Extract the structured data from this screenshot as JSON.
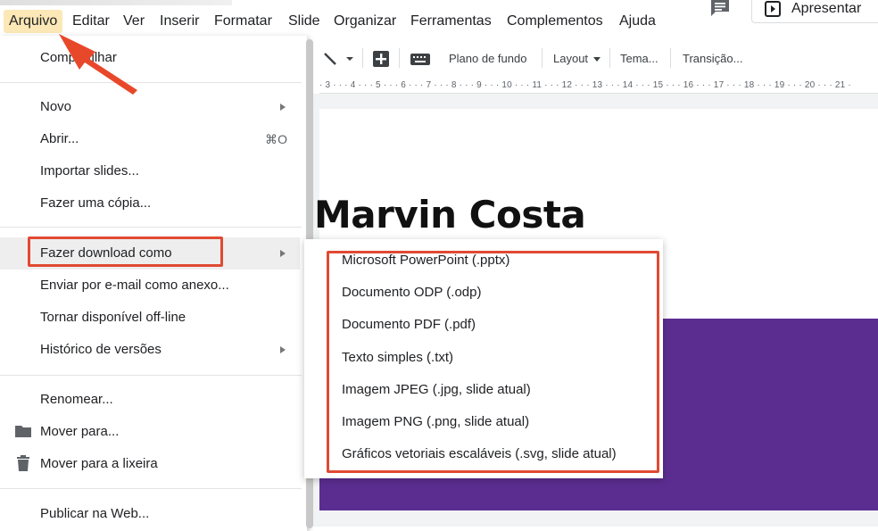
{
  "menubar": {
    "items": [
      {
        "label": "Arquivo"
      },
      {
        "label": "Editar"
      },
      {
        "label": "Ver"
      },
      {
        "label": "Inserir"
      },
      {
        "label": "Formatar"
      },
      {
        "label": "Slide"
      },
      {
        "label": "Organizar"
      },
      {
        "label": "Ferramentas"
      },
      {
        "label": "Complementos"
      },
      {
        "label": "Ajuda"
      }
    ],
    "present_label": "Apresentar"
  },
  "toolbar": {
    "background_label": "Plano de fundo",
    "layout_label": "Layout",
    "theme_label": "Tema...",
    "transition_label": "Transição..."
  },
  "ruler": {
    "ticks": "· 3 · · · 4 · · · 5 · · · 6 · · · 7 · · · 8 · · · 9 · · · 10 · · · 11 · · · 12 · · · 13 · · · 14 · · · 15 · · · 16 · · · 17 · · · 18 · · · 19 · · · 20 · · · 21 ·"
  },
  "slide": {
    "title": "Marvin Costa",
    "band_color": "#5c2d91"
  },
  "file_menu": {
    "share": "Compartilhar",
    "new": "Novo",
    "open": "Abrir...",
    "open_shortcut": "⌘O",
    "import_slides": "Importar slides...",
    "make_copy": "Fazer uma cópia...",
    "download_as": "Fazer download como",
    "email_attachment": "Enviar por e-mail como anexo...",
    "offline": "Tornar disponível off-line",
    "version_history": "Histórico de versões",
    "rename": "Renomear...",
    "move_to": "Mover para...",
    "trash": "Mover para a lixeira",
    "publish": "Publicar na Web..."
  },
  "download_submenu": {
    "items": [
      {
        "label": "Microsoft PowerPoint (.pptx)"
      },
      {
        "label": "Documento ODP (.odp)"
      },
      {
        "label": "Documento PDF (.pdf)"
      },
      {
        "label": "Texto simples (.txt)"
      },
      {
        "label": "Imagem JPEG (.jpg, slide atual)"
      },
      {
        "label": "Imagem PNG (.png, slide atual)"
      },
      {
        "label": "Gráficos vetoriais escaláveis (.svg, slide atual)"
      }
    ]
  },
  "colors": {
    "annotation": "#e04a32",
    "active_menu": "#fbe8b6",
    "slide_band": "#5c2d91"
  }
}
